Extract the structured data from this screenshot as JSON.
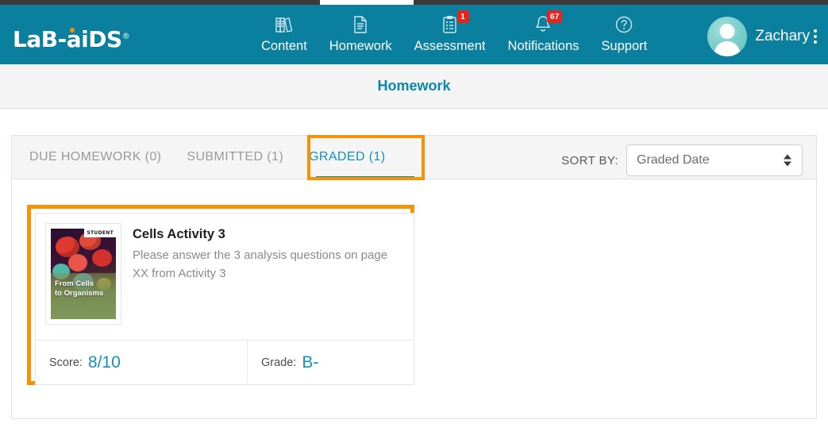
{
  "brand": {
    "logo_text_1": "LaB",
    "logo_sep": "-",
    "logo_text_2": "a",
    "logo_text_3": "DS",
    "logo_i": "i",
    "logo_tm": "®",
    "accent_orange": "#f59304",
    "teal": "#0a7f9e",
    "link_teal": "#1292b8",
    "badge_red": "#e8231b"
  },
  "nav": {
    "items": [
      {
        "label": "Content",
        "icon": "books-icon",
        "badge": null
      },
      {
        "label": "Homework",
        "icon": "document-icon",
        "badge": null,
        "active": true
      },
      {
        "label": "Assessment",
        "icon": "clipboard-icon",
        "badge": "1"
      },
      {
        "label": "Notifications",
        "icon": "bell-icon",
        "badge": "67"
      },
      {
        "label": "Support",
        "icon": "question-circle-icon",
        "badge": null
      }
    ],
    "user": {
      "name": "Zachary",
      "avatar_icon": "user-avatar-icon",
      "menu_icon": "kebab-menu-icon"
    }
  },
  "subheader": {
    "title": "Homework"
  },
  "tabs": [
    {
      "label": "DUE HOMEWORK (0)",
      "active": false
    },
    {
      "label": "SUBMITTED (1)",
      "active": false
    },
    {
      "label": "GRADED (1)",
      "active": true
    }
  ],
  "sort": {
    "label": "SORT BY:",
    "selected": "Graded Date",
    "options": [
      "Graded Date"
    ],
    "arrows_icon": "updown-arrows-icon"
  },
  "homework_cards": [
    {
      "title": "Cells Activity 3",
      "description": "Please answer the 3 analysis questions on page XX from Activity 3",
      "thumbnail": {
        "badge": "STUDENT",
        "title_line_1": "From Cells",
        "title_line_2": "to Organisms",
        "alt": "book-cover-from-cells-to-organisms"
      },
      "score_label": "Score:",
      "score_value": "8/10",
      "grade_label": "Grade:",
      "grade_value": "B-"
    }
  ]
}
